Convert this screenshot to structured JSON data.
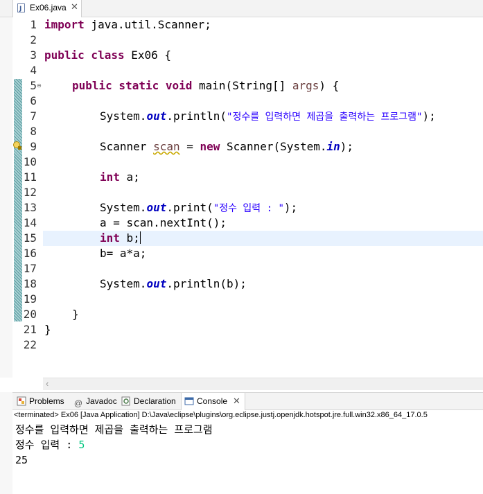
{
  "editor": {
    "tab_name": "Ex06.java",
    "line_numbers": [
      "1",
      "2",
      "3",
      "4",
      "5",
      "6",
      "7",
      "8",
      "9",
      "10",
      "11",
      "12",
      "13",
      "14",
      "15",
      "16",
      "17",
      "18",
      "19",
      "20",
      "21",
      "22"
    ],
    "code": {
      "l1_kw": "import",
      "l1_rest": " java.util.Scanner;",
      "l3_kw": "public class",
      "l3_rest": " Ex06 {",
      "l5_kw": "public static void",
      "l5_a": " main(String[] ",
      "l5_var": "args",
      "l5_b": ") {",
      "l7_a": "System.",
      "l7_fld": "out",
      "l7_b": ".println(",
      "l7_str": "\"정수를 입력하면 제곱을 출력하는 프로그램\"",
      "l7_c": ");",
      "l9_a": "Scanner ",
      "l9_var": "scan",
      "l9_b": " = ",
      "l9_kw": "new",
      "l9_c": " Scanner(System.",
      "l9_fld": "in",
      "l9_d": ");",
      "l11_kw": "int",
      "l11_rest": " a;",
      "l13_a": "System.",
      "l13_fld": "out",
      "l13_b": ".print(",
      "l13_str": "\"정수 입력 : \"",
      "l13_c": ");",
      "l14": "a = scan.nextInt();",
      "l15_kw": "int",
      "l15_rest": " b;",
      "l16": "b= a*a;",
      "l18_a": "System.",
      "l18_fld": "out",
      "l18_b": ".println(b);",
      "l20": "}",
      "l21": "}"
    }
  },
  "panel": {
    "tabs": [
      {
        "label": "Problems",
        "icon": "problems-icon"
      },
      {
        "label": "Javadoc",
        "icon": "javadoc-icon"
      },
      {
        "label": "Declaration",
        "icon": "declaration-icon"
      },
      {
        "label": "Console",
        "icon": "console-icon"
      }
    ],
    "console_status": "<terminated> Ex06 [Java Application] D:\\Java\\eclipse\\plugins\\org.eclipse.justj.openjdk.hotspot.jre.full.win32.x86_64_17.0.5",
    "output": {
      "line1": "정수를 입력하면 제곱을 출력하는 프로그램",
      "line2_prompt": "정수 입력 : ",
      "line2_input": "5",
      "line3": "25"
    }
  },
  "colors": {
    "keyword": "#7f0055",
    "string": "#2a00ff",
    "field": "#0000c0",
    "console_input": "#00c87f",
    "current_line": "#e8f2fe"
  }
}
